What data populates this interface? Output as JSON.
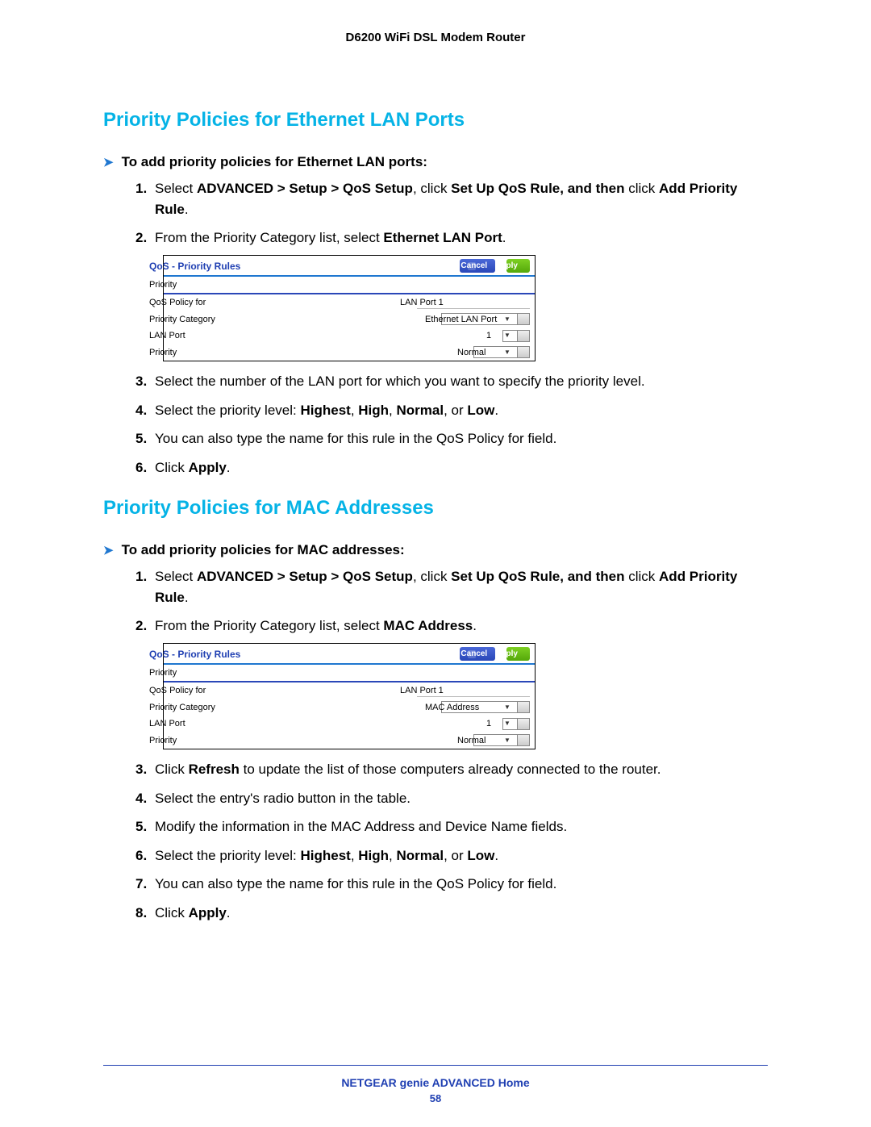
{
  "doc": {
    "header": "D6200 WiFi DSL Modem Router",
    "footer_title": "NETGEAR genie ADVANCED Home",
    "page_number": "58"
  },
  "section1": {
    "title": "Priority Policies for Ethernet LAN Ports",
    "task_label": "To add priority policies for Ethernet LAN ports:",
    "steps": {
      "s1_pre": "Select ",
      "s1_b1": "ADVANCED > Setup > QoS Setup",
      "s1_mid": ", click ",
      "s1_b2": "Set Up QoS Rule, and then ",
      "s1_post": "click ",
      "s1_b3": "Add Priority Rule",
      "s1_end": ".",
      "s2_pre": "From the Priority Category list, select ",
      "s2_b": "Ethernet LAN Port",
      "s2_end": ".",
      "s3": "Select the number of the LAN port for which you want to specify the priority level.",
      "s4_pre": "Select the priority level: ",
      "s4_b1": "Highest",
      "s4_b2": "High",
      "s4_b3": "Normal",
      "s4_b4": "Low",
      "s4_end": ".",
      "s5": "You can also type the name for this rule in the QoS Policy for field.",
      "s6_pre": "Click ",
      "s6_b": "Apply",
      "s6_end": "."
    },
    "panel": {
      "title": "QoS - Priority Rules",
      "cancel_label": "Cancel",
      "apply_label": "Apply",
      "section_label": "Priority",
      "row1_label": "QoS Policy for",
      "row1_value": "LAN Port 1",
      "row2_label": "Priority Category",
      "row2_value": "Ethernet LAN Port",
      "row3_label": "LAN Port",
      "row3_value": "1",
      "row4_label": "Priority",
      "row4_value": "Normal"
    }
  },
  "section2": {
    "title": "Priority Policies for MAC Addresses",
    "task_label": "To add priority policies for MAC addresses:",
    "steps": {
      "s1_pre": "Select ",
      "s1_b1": "ADVANCED > Setup > QoS Setup",
      "s1_mid": ", click ",
      "s1_b2": "Set Up QoS Rule, and then ",
      "s1_post": "click ",
      "s1_b3": "Add Priority Rule",
      "s1_end": ".",
      "s2_pre": "From the Priority Category list, select ",
      "s2_b": "MAC Address",
      "s2_end": ".",
      "s3_pre": "Click ",
      "s3_b": "Refresh",
      "s3_post": " to update the list of those computers already connected to the router.",
      "s4": "Select the entry's radio button in the table.",
      "s5": "Modify the information in the MAC Address and Device Name fields.",
      "s6_pre": "Select the priority level: ",
      "s6_b1": "Highest",
      "s6_b2": "High",
      "s6_b3": "Normal",
      "s6_b4": "Low",
      "s6_end": ".",
      "s7": "You can also type the name for this rule in the QoS Policy for field.",
      "s8_pre": "Click ",
      "s8_b": "Apply",
      "s8_end": "."
    },
    "panel": {
      "title": "QoS - Priority Rules",
      "cancel_label": "Cancel",
      "apply_label": "Apply",
      "section_label": "Priority",
      "row1_label": "QoS Policy for",
      "row1_value": "LAN Port 1",
      "row2_label": "Priority Category",
      "row2_value": "MAC Address",
      "row3_label": "LAN Port",
      "row3_value": "1",
      "row4_label": "Priority",
      "row4_value": "Normal"
    }
  },
  "glyphs": {
    "chevron": "➤",
    "x": "×",
    "dd": "▼",
    "arr": "▸"
  },
  "txt": {
    "comma": ", ",
    "or": ", or "
  }
}
